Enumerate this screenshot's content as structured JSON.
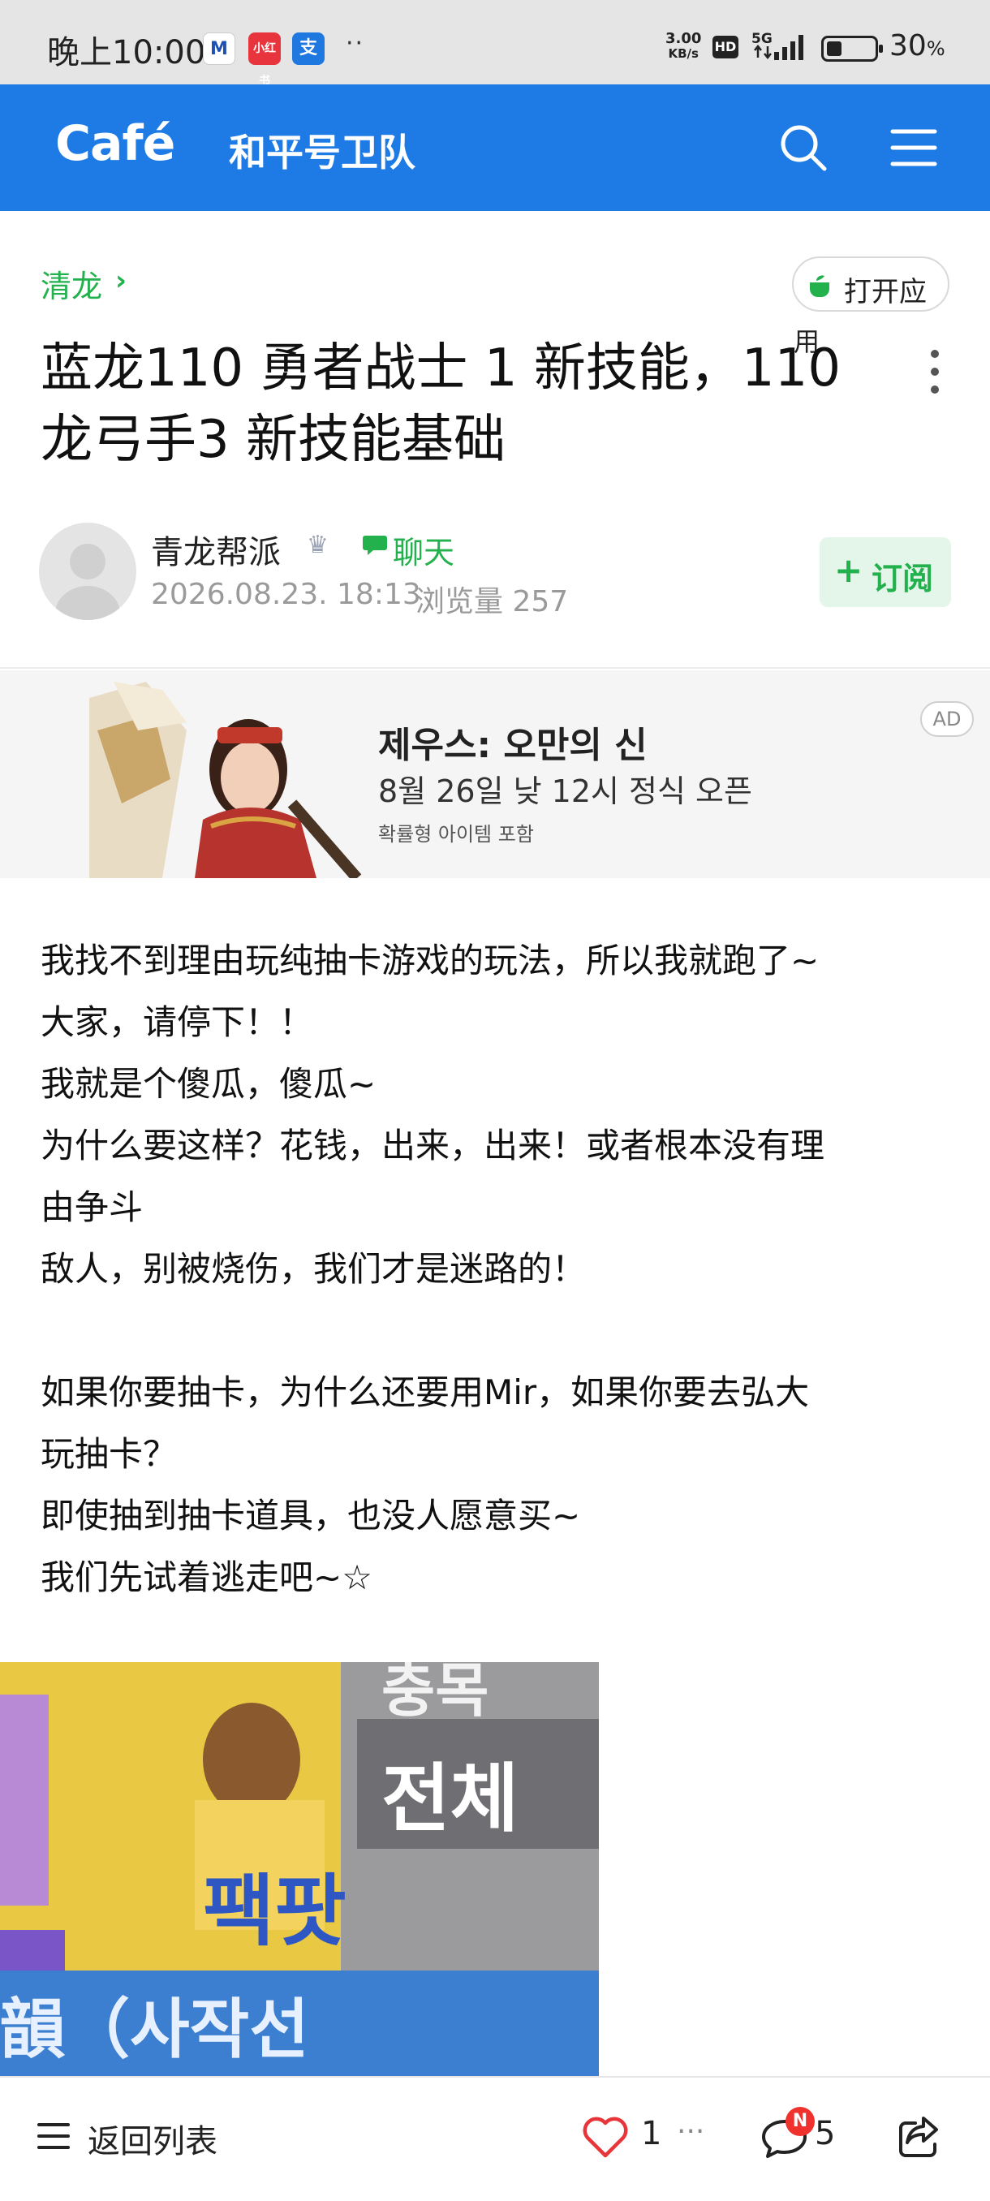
{
  "status_bar": {
    "time": "晚上10:00",
    "app_m": "M",
    "app_x": "小红书",
    "app_z": "支",
    "dots": "··",
    "speed_value": "3.00",
    "speed_unit": "KB/s",
    "hd": "HD",
    "network": "5G",
    "battery": "30",
    "battery_unit": "%"
  },
  "app_bar": {
    "logo": "Café",
    "cafe_name": "和平号卫队",
    "search_icon": "search-icon",
    "menu_icon": "hamburger-menu-icon",
    "color": "#1e7be5"
  },
  "article": {
    "board": "清龙",
    "open_app_label": "打开应",
    "open_app_overflow": "用",
    "title": "蓝龙110 勇者战士 1 新技能，110 龙弓手3 新技能基础",
    "author": "青龙帮派",
    "chat_label": "聊天",
    "date": "2026.08.23. 18:13",
    "views": "浏览量 257",
    "subscribe_label": "订阅",
    "accent": "#22b14c"
  },
  "ad": {
    "title": "제우스: 오만의 신",
    "subtitle": "8월 26일 낮 12시 정식 오픈",
    "note": "확률형 아이템 포함",
    "badge": "AD"
  },
  "body": {
    "lines": [
      "我找不到理由玩纯抽卡游戏的玩法，所以我就跑了~",
      "大家，请停下！！",
      "我就是个傻瓜，傻瓜~",
      "为什么要这样？花钱，出来，出来！或者根本没有理",
      "由争斗",
      "敌人，别被烧伤，我们才是迷路的！",
      "",
      "如果你要抽卡，为什么还要用Mir，如果你要去弘大",
      "玩抽卡？",
      "即使抽到抽卡道具，也没人愿意买~",
      "我们先试着逃走吧~☆"
    ]
  },
  "image_text": {
    "top": "충목",
    "mid": "전체",
    "low": "팩팟",
    "bottom": "韻（사작선"
  },
  "bottom_bar": {
    "back_label": "返回列表",
    "likes": "1",
    "more": "···",
    "new_badge": "N",
    "comments": "5"
  }
}
